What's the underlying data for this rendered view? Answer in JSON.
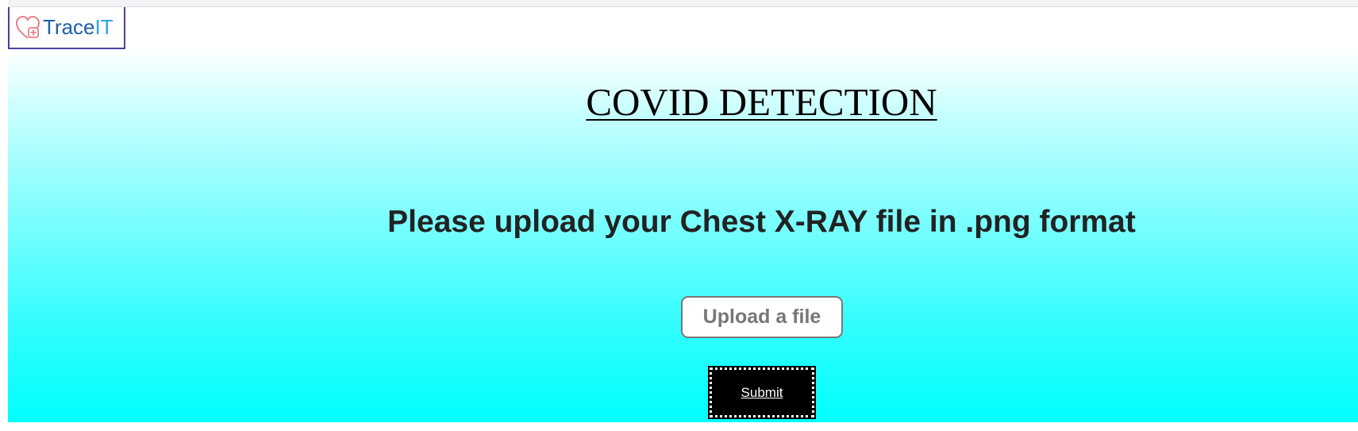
{
  "brand": {
    "logo_icon": "heart-cross-icon",
    "name_main": "Trace",
    "name_accent": "IT",
    "colors": {
      "main": "#1f5fa8",
      "accent": "#2aa7e0",
      "icon": "#e87f8a",
      "border": "#4b3f9e"
    }
  },
  "page": {
    "title": "COVID DETECTION",
    "instruction": "Please upload your Chest X-RAY file in .png format",
    "background_gradient": [
      "#ffffff",
      "#00ffff"
    ]
  },
  "form": {
    "upload_label": "Upload a file",
    "submit_label": "Submit"
  }
}
